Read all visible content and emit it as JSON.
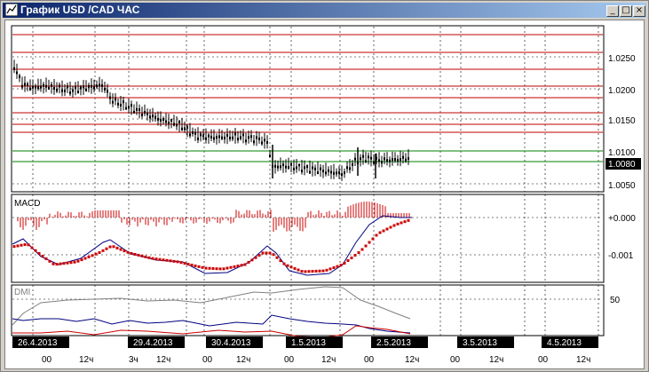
{
  "window": {
    "title": "График USD /CAD ЧАС",
    "buttons": {
      "minimize": "_",
      "maximize": "□",
      "close": "×"
    }
  },
  "price_panel": {
    "axis_labels": [
      "1.0250",
      "1.0200",
      "1.0150",
      "1.0100",
      "1.0050"
    ],
    "current_price": "1.0080"
  },
  "macd_panel": {
    "label": "MACD",
    "axis_labels": [
      "+0.000",
      "-0.001"
    ]
  },
  "dmi_panel": {
    "label": "DMI",
    "axis_labels": [
      "50"
    ]
  },
  "time_axis": {
    "dates": [
      "26.4.2013",
      "29.4.2013",
      "30.4.2013",
      "1.5.2013",
      "2.5.2013",
      "3.5.2013",
      "4.5.2013"
    ],
    "hours": [
      {
        "text": "00"
      },
      {
        "text": "12ч"
      },
      {
        "text": "3ч"
      },
      {
        "text": "12ч"
      },
      {
        "text": "00"
      },
      {
        "text": "12ч"
      },
      {
        "text": "00"
      },
      {
        "text": "12ч"
      },
      {
        "text": "00"
      },
      {
        "text": "12ч"
      },
      {
        "text": "00"
      },
      {
        "text": "12ч"
      },
      {
        "text": "00"
      },
      {
        "text": "12ч"
      }
    ]
  },
  "colors": {
    "resistance": "#c00000",
    "support": "#008000",
    "candle": "#000000",
    "macd_hist": "#cc0000",
    "macd_line": "#000080",
    "macd_signal": "#cc0000",
    "dmi_adx": "#808080",
    "dmi_plus": "#000080",
    "dmi_minus": "#cc0000"
  }
}
